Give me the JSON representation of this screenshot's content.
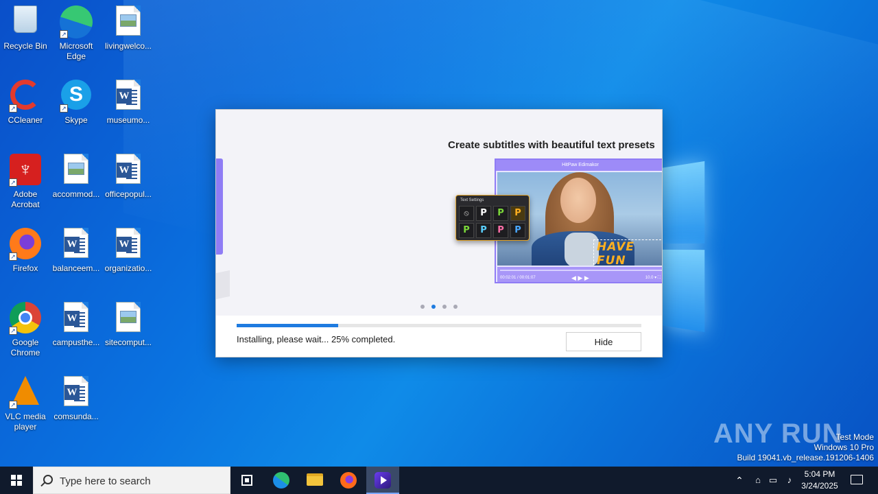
{
  "desktop": {
    "icons": [
      {
        "label": "Recycle Bin",
        "icon": "recycle-bin-icon"
      },
      {
        "label": "Microsoft Edge",
        "icon": "edge-icon"
      },
      {
        "label": "livingwelco...",
        "icon": "image-file-icon"
      },
      {
        "label": "CCleaner",
        "icon": "ccleaner-icon"
      },
      {
        "label": "Skype",
        "icon": "skype-icon"
      },
      {
        "label": "museumo...",
        "icon": "word-doc-icon"
      },
      {
        "label": "Adobe Acrobat",
        "icon": "acrobat-icon"
      },
      {
        "label": "accommod...",
        "icon": "image-file-icon"
      },
      {
        "label": "officepopul...",
        "icon": "word-doc-icon"
      },
      {
        "label": "Firefox",
        "icon": "firefox-icon"
      },
      {
        "label": "balanceem...",
        "icon": "word-doc-icon"
      },
      {
        "label": "organizatio...",
        "icon": "word-doc-icon"
      },
      {
        "label": "Google Chrome",
        "icon": "chrome-icon"
      },
      {
        "label": "campusthe...",
        "icon": "word-doc-icon"
      },
      {
        "label": "sitecomput...",
        "icon": "image-file-icon"
      },
      {
        "label": "VLC media player",
        "icon": "vlc-icon"
      },
      {
        "label": "comsunda...",
        "icon": "word-doc-icon"
      }
    ]
  },
  "installer": {
    "slide_title": "Create subtitles with beautiful text presets",
    "app_title": "HitPaw Edimakor",
    "text_settings_title": "Text Settings",
    "preset_glyph": "P",
    "none_glyph": "⦸",
    "caption": "HAVE FUN",
    "time_left": "00:02:01 / 00:01:07",
    "time_right": "10.0 ▾  ⛶",
    "controls": "◀  ▶  ▶",
    "progress_percent": 25,
    "status": "Installing, please wait... 25% completed.",
    "hide_label": "Hide",
    "carousel_dots": 4,
    "carousel_active": 1
  },
  "watermark": {
    "brand": "ANY RUN",
    "line1": "Test Mode",
    "line2": "Windows 10 Pro",
    "line3": "Build 19041.vb_release.191206-1406"
  },
  "taskbar": {
    "search_placeholder": "Type here to search",
    "time": "5:04 PM",
    "date": "3/24/2025"
  },
  "colors": {
    "accent": "#1e7be0",
    "brand_purple": "#8f7cf5"
  }
}
